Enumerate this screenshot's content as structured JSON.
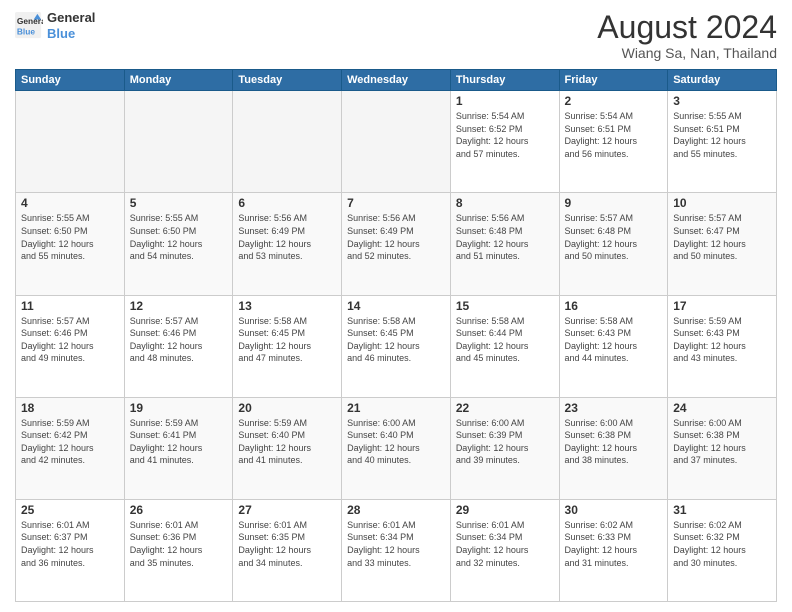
{
  "header": {
    "logo_line1": "General",
    "logo_line2": "Blue",
    "month": "August 2024",
    "location": "Wiang Sa, Nan, Thailand"
  },
  "weekdays": [
    "Sunday",
    "Monday",
    "Tuesday",
    "Wednesday",
    "Thursday",
    "Friday",
    "Saturday"
  ],
  "weeks": [
    [
      {
        "day": "",
        "info": ""
      },
      {
        "day": "",
        "info": ""
      },
      {
        "day": "",
        "info": ""
      },
      {
        "day": "",
        "info": ""
      },
      {
        "day": "1",
        "info": "Sunrise: 5:54 AM\nSunset: 6:52 PM\nDaylight: 12 hours\nand 57 minutes."
      },
      {
        "day": "2",
        "info": "Sunrise: 5:54 AM\nSunset: 6:51 PM\nDaylight: 12 hours\nand 56 minutes."
      },
      {
        "day": "3",
        "info": "Sunrise: 5:55 AM\nSunset: 6:51 PM\nDaylight: 12 hours\nand 55 minutes."
      }
    ],
    [
      {
        "day": "4",
        "info": "Sunrise: 5:55 AM\nSunset: 6:50 PM\nDaylight: 12 hours\nand 55 minutes."
      },
      {
        "day": "5",
        "info": "Sunrise: 5:55 AM\nSunset: 6:50 PM\nDaylight: 12 hours\nand 54 minutes."
      },
      {
        "day": "6",
        "info": "Sunrise: 5:56 AM\nSunset: 6:49 PM\nDaylight: 12 hours\nand 53 minutes."
      },
      {
        "day": "7",
        "info": "Sunrise: 5:56 AM\nSunset: 6:49 PM\nDaylight: 12 hours\nand 52 minutes."
      },
      {
        "day": "8",
        "info": "Sunrise: 5:56 AM\nSunset: 6:48 PM\nDaylight: 12 hours\nand 51 minutes."
      },
      {
        "day": "9",
        "info": "Sunrise: 5:57 AM\nSunset: 6:48 PM\nDaylight: 12 hours\nand 50 minutes."
      },
      {
        "day": "10",
        "info": "Sunrise: 5:57 AM\nSunset: 6:47 PM\nDaylight: 12 hours\nand 50 minutes."
      }
    ],
    [
      {
        "day": "11",
        "info": "Sunrise: 5:57 AM\nSunset: 6:46 PM\nDaylight: 12 hours\nand 49 minutes."
      },
      {
        "day": "12",
        "info": "Sunrise: 5:57 AM\nSunset: 6:46 PM\nDaylight: 12 hours\nand 48 minutes."
      },
      {
        "day": "13",
        "info": "Sunrise: 5:58 AM\nSunset: 6:45 PM\nDaylight: 12 hours\nand 47 minutes."
      },
      {
        "day": "14",
        "info": "Sunrise: 5:58 AM\nSunset: 6:45 PM\nDaylight: 12 hours\nand 46 minutes."
      },
      {
        "day": "15",
        "info": "Sunrise: 5:58 AM\nSunset: 6:44 PM\nDaylight: 12 hours\nand 45 minutes."
      },
      {
        "day": "16",
        "info": "Sunrise: 5:58 AM\nSunset: 6:43 PM\nDaylight: 12 hours\nand 44 minutes."
      },
      {
        "day": "17",
        "info": "Sunrise: 5:59 AM\nSunset: 6:43 PM\nDaylight: 12 hours\nand 43 minutes."
      }
    ],
    [
      {
        "day": "18",
        "info": "Sunrise: 5:59 AM\nSunset: 6:42 PM\nDaylight: 12 hours\nand 42 minutes."
      },
      {
        "day": "19",
        "info": "Sunrise: 5:59 AM\nSunset: 6:41 PM\nDaylight: 12 hours\nand 41 minutes."
      },
      {
        "day": "20",
        "info": "Sunrise: 5:59 AM\nSunset: 6:40 PM\nDaylight: 12 hours\nand 41 minutes."
      },
      {
        "day": "21",
        "info": "Sunrise: 6:00 AM\nSunset: 6:40 PM\nDaylight: 12 hours\nand 40 minutes."
      },
      {
        "day": "22",
        "info": "Sunrise: 6:00 AM\nSunset: 6:39 PM\nDaylight: 12 hours\nand 39 minutes."
      },
      {
        "day": "23",
        "info": "Sunrise: 6:00 AM\nSunset: 6:38 PM\nDaylight: 12 hours\nand 38 minutes."
      },
      {
        "day": "24",
        "info": "Sunrise: 6:00 AM\nSunset: 6:38 PM\nDaylight: 12 hours\nand 37 minutes."
      }
    ],
    [
      {
        "day": "25",
        "info": "Sunrise: 6:01 AM\nSunset: 6:37 PM\nDaylight: 12 hours\nand 36 minutes."
      },
      {
        "day": "26",
        "info": "Sunrise: 6:01 AM\nSunset: 6:36 PM\nDaylight: 12 hours\nand 35 minutes."
      },
      {
        "day": "27",
        "info": "Sunrise: 6:01 AM\nSunset: 6:35 PM\nDaylight: 12 hours\nand 34 minutes."
      },
      {
        "day": "28",
        "info": "Sunrise: 6:01 AM\nSunset: 6:34 PM\nDaylight: 12 hours\nand 33 minutes."
      },
      {
        "day": "29",
        "info": "Sunrise: 6:01 AM\nSunset: 6:34 PM\nDaylight: 12 hours\nand 32 minutes."
      },
      {
        "day": "30",
        "info": "Sunrise: 6:02 AM\nSunset: 6:33 PM\nDaylight: 12 hours\nand 31 minutes."
      },
      {
        "day": "31",
        "info": "Sunrise: 6:02 AM\nSunset: 6:32 PM\nDaylight: 12 hours\nand 30 minutes."
      }
    ]
  ]
}
